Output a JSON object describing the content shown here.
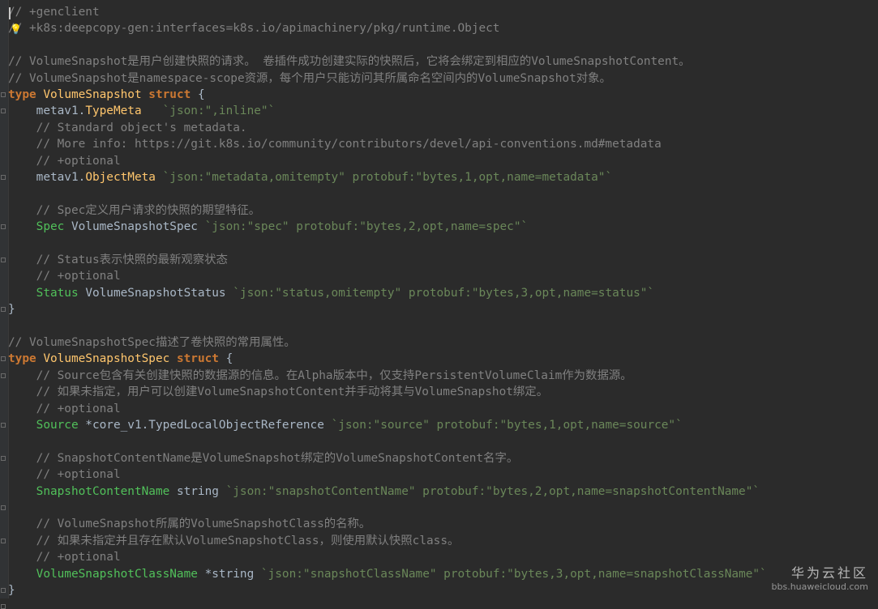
{
  "code": {
    "lines": [
      {
        "tokens": [
          {
            "t": "// +genclient",
            "k": "c"
          }
        ]
      },
      {
        "tokens": [
          {
            "t": "// +k8s:deepcopy-gen:interfaces=k8s.io/apimachinery/pkg/runtime.Object",
            "k": "c"
          }
        ]
      },
      {
        "tokens": []
      },
      {
        "tokens": [
          {
            "t": "// VolumeSnapshot是用户创建快照的请求。 卷插件成功创建实际的快照后，它将会绑定到相应的VolumeSnapshotContent。",
            "k": "c"
          }
        ]
      },
      {
        "tokens": [
          {
            "t": "// VolumeSnapshot是namespace-scope资源，每个用户只能访问其所属命名空间内的VolumeSnapshot对象。",
            "k": "c"
          }
        ]
      },
      {
        "tokens": [
          {
            "t": "type",
            "k": "kw"
          },
          {
            "t": " ",
            "k": "pl"
          },
          {
            "t": "VolumeSnapshot",
            "k": "ty"
          },
          {
            "t": " ",
            "k": "pl"
          },
          {
            "t": "struct",
            "k": "kw"
          },
          {
            "t": " {",
            "k": "pl"
          }
        ]
      },
      {
        "tokens": [
          {
            "t": "    metav1.",
            "k": "pl"
          },
          {
            "t": "TypeMeta",
            "k": "pkgtype"
          },
          {
            "t": "   ",
            "k": "pl"
          },
          {
            "t": "`json:\",inline\"`",
            "k": "str"
          }
        ]
      },
      {
        "tokens": [
          {
            "t": "    // Standard object's metadata.",
            "k": "c"
          }
        ]
      },
      {
        "tokens": [
          {
            "t": "    // More info: https://git.k8s.io/community/contributors/devel/api-conventions.md#metadata",
            "k": "c"
          }
        ]
      },
      {
        "tokens": [
          {
            "t": "    // +optional",
            "k": "c"
          }
        ]
      },
      {
        "tokens": [
          {
            "t": "    metav1.",
            "k": "pl"
          },
          {
            "t": "ObjectMeta",
            "k": "pkgtype"
          },
          {
            "t": " ",
            "k": "pl"
          },
          {
            "t": "`json:\"metadata,omitempty\" protobuf:\"bytes,1,opt,name=metadata\"`",
            "k": "str"
          }
        ]
      },
      {
        "tokens": []
      },
      {
        "tokens": [
          {
            "t": "    // Spec定义用户请求的快照的期望特征。",
            "k": "c"
          }
        ]
      },
      {
        "tokens": [
          {
            "t": "    ",
            "k": "pl"
          },
          {
            "t": "Spec",
            "k": "fld"
          },
          {
            "t": " ",
            "k": "pl"
          },
          {
            "t": "VolumeSnapshotSpec",
            "k": "pl"
          },
          {
            "t": " ",
            "k": "pl"
          },
          {
            "t": "`json:\"spec\" protobuf:\"bytes,2,opt,name=spec\"`",
            "k": "str"
          }
        ]
      },
      {
        "tokens": []
      },
      {
        "tokens": [
          {
            "t": "    // Status表示快照的最新观察状态",
            "k": "c"
          }
        ]
      },
      {
        "tokens": [
          {
            "t": "    // +optional",
            "k": "c"
          }
        ]
      },
      {
        "tokens": [
          {
            "t": "    ",
            "k": "pl"
          },
          {
            "t": "Status",
            "k": "fld"
          },
          {
            "t": " ",
            "k": "pl"
          },
          {
            "t": "VolumeSnapshotStatus",
            "k": "pl"
          },
          {
            "t": " ",
            "k": "pl"
          },
          {
            "t": "`json:\"status,omitempty\" protobuf:\"bytes,3,opt,name=status\"`",
            "k": "str"
          }
        ]
      },
      {
        "tokens": [
          {
            "t": "}",
            "k": "pl"
          }
        ]
      },
      {
        "tokens": []
      },
      {
        "tokens": [
          {
            "t": "// VolumeSnapshotSpec描述了卷快照的常用属性。",
            "k": "c"
          }
        ]
      },
      {
        "tokens": [
          {
            "t": "type",
            "k": "kw"
          },
          {
            "t": " ",
            "k": "pl"
          },
          {
            "t": "VolumeSnapshotSpec",
            "k": "ty"
          },
          {
            "t": " ",
            "k": "pl"
          },
          {
            "t": "struct",
            "k": "kw"
          },
          {
            "t": " {",
            "k": "pl"
          }
        ]
      },
      {
        "tokens": [
          {
            "t": "    // Source包含有关创建快照的数据源的信息。在Alpha版本中，仅支持PersistentVolumeClaim作为数据源。",
            "k": "c"
          }
        ]
      },
      {
        "tokens": [
          {
            "t": "    // 如果未指定，用户可以创建VolumeSnapshotContent并手动将其与VolumeSnapshot绑定。",
            "k": "c"
          }
        ]
      },
      {
        "tokens": [
          {
            "t": "    // +optional",
            "k": "c"
          }
        ]
      },
      {
        "tokens": [
          {
            "t": "    ",
            "k": "pl"
          },
          {
            "t": "Source",
            "k": "fld"
          },
          {
            "t": " *core_v1.",
            "k": "pl"
          },
          {
            "t": "TypedLocalObjectReference",
            "k": "pl"
          },
          {
            "t": " ",
            "k": "pl"
          },
          {
            "t": "`json:\"source\" protobuf:\"bytes,1,opt,name=source\"`",
            "k": "str"
          }
        ]
      },
      {
        "tokens": []
      },
      {
        "tokens": [
          {
            "t": "    // SnapshotContentName是VolumeSnapshot绑定的VolumeSnapshotContent名字。",
            "k": "c"
          }
        ]
      },
      {
        "tokens": [
          {
            "t": "    // +optional",
            "k": "c"
          }
        ]
      },
      {
        "tokens": [
          {
            "t": "    ",
            "k": "pl"
          },
          {
            "t": "SnapshotContentName",
            "k": "fld"
          },
          {
            "t": " string ",
            "k": "pl"
          },
          {
            "t": "`json:\"snapshotContentName\" protobuf:\"bytes,2,opt,name=snapshotContentName\"`",
            "k": "str"
          }
        ]
      },
      {
        "tokens": []
      },
      {
        "tokens": [
          {
            "t": "    // VolumeSnapshot所属的VolumeSnapshotClass的名称。",
            "k": "c"
          }
        ]
      },
      {
        "tokens": [
          {
            "t": "    // 如果未指定并且存在默认VolumeSnapshotClass，则使用默认快照class。",
            "k": "c"
          }
        ]
      },
      {
        "tokens": [
          {
            "t": "    // +optional",
            "k": "c"
          }
        ]
      },
      {
        "tokens": [
          {
            "t": "    ",
            "k": "pl"
          },
          {
            "t": "VolumeSnapshotClassName",
            "k": "fld"
          },
          {
            "t": " *string ",
            "k": "pl"
          },
          {
            "t": "`json:\"snapshotClassName\" protobuf:\"bytes,3,opt,name=snapshotClassName\"`",
            "k": "str"
          }
        ]
      },
      {
        "tokens": [
          {
            "t": "}",
            "k": "pl"
          }
        ]
      }
    ]
  },
  "watermark": {
    "title": "华为云社区",
    "url": "bbs.huaweicloud.com"
  },
  "colors": {
    "background": "#2b2b2b",
    "comment": "#808080",
    "keyword": "#cc7832",
    "type_name": "#ffc66d",
    "field": "#51c05a",
    "tag_string": "#6a8759",
    "plain": "#a9b7c6"
  },
  "icons": [
    "intention-bulb-icon",
    "fold-marker-icon",
    "text-caret"
  ]
}
